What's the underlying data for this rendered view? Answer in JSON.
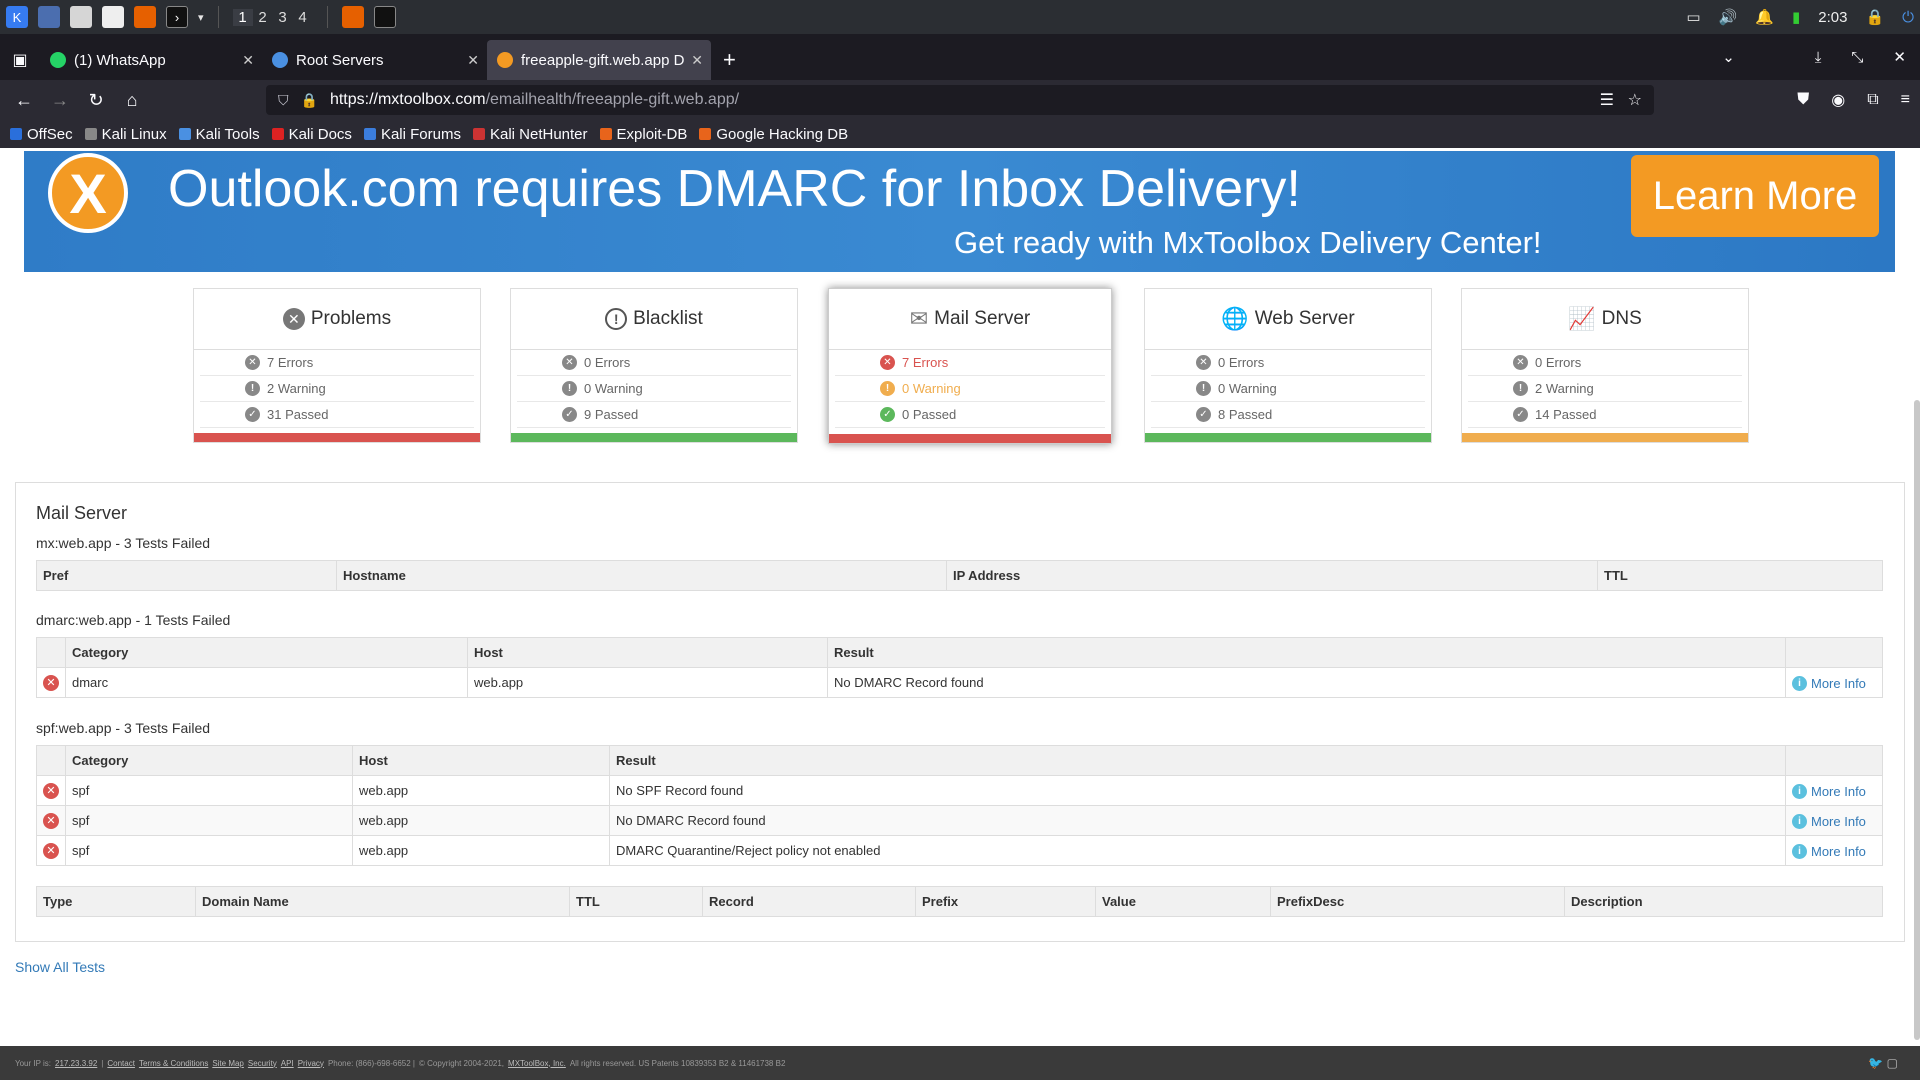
{
  "taskbar": {
    "workspaces": [
      "1",
      "2",
      "3",
      "4"
    ],
    "clock": "2:03"
  },
  "tabs": [
    {
      "label": "(1) WhatsApp"
    },
    {
      "label": "Root Servers"
    },
    {
      "label": "freeapple-gift.web.app D"
    }
  ],
  "url": {
    "host": "https://mxtoolbox.com",
    "path": "/emailhealth/freeapple-gift.web.app/"
  },
  "bookmarks": [
    "OffSec",
    "Kali Linux",
    "Kali Tools",
    "Kali Docs",
    "Kali Forums",
    "Kali NetHunter",
    "Exploit-DB",
    "Google Hacking DB"
  ],
  "banner": {
    "title": "Outlook.com requires DMARC for Inbox Delivery!",
    "subtitle": "Get ready with MxToolbox Delivery Center!",
    "button": "Learn More"
  },
  "cards": [
    {
      "title": "Problems",
      "errors": "7 Errors",
      "warning": "2 Warning",
      "passed": "31 Passed",
      "bar_color": "#d9534f"
    },
    {
      "title": "Blacklist",
      "errors": "0 Errors",
      "warning": "0 Warning",
      "passed": "9 Passed",
      "bar_color": "#5cb85c"
    },
    {
      "title": "Mail Server",
      "errors": "7 Errors",
      "warning": "0 Warning",
      "passed": "0 Passed",
      "bar_color": "#d9534f"
    },
    {
      "title": "Web Server",
      "errors": "0 Errors",
      "warning": "0 Warning",
      "passed": "8 Passed",
      "bar_color": "#5cb85c"
    },
    {
      "title": "DNS",
      "errors": "0 Errors",
      "warning": "2 Warning",
      "passed": "14 Passed",
      "bar_color": "#f0ad4e"
    }
  ],
  "panel": {
    "title": "Mail Server",
    "mx": {
      "heading": "mx:web.app - 3 Tests Failed",
      "cols": [
        "Pref",
        "Hostname",
        "IP Address",
        "TTL"
      ]
    },
    "dmarc": {
      "heading": "dmarc:web.app - 1 Tests Failed",
      "cols": [
        "Category",
        "Host",
        "Result"
      ],
      "rows": [
        {
          "category": "dmarc",
          "host": "web.app",
          "result": "No DMARC Record found",
          "info": "More Info"
        }
      ]
    },
    "spf": {
      "heading": "spf:web.app - 3 Tests Failed",
      "cols": [
        "Category",
        "Host",
        "Result"
      ],
      "rows": [
        {
          "category": "spf",
          "host": "web.app",
          "result": "No SPF Record found",
          "info": "More Info"
        },
        {
          "category": "spf",
          "host": "web.app",
          "result": "No DMARC Record found",
          "info": "More Info"
        },
        {
          "category": "spf",
          "host": "web.app",
          "result": "DMARC Quarantine/Reject policy not enabled",
          "info": "More Info"
        }
      ]
    },
    "records": {
      "cols": [
        "Type",
        "Domain Name",
        "TTL",
        "Record",
        "Prefix",
        "Value",
        "PrefixDesc",
        "Description"
      ]
    }
  },
  "show_all": "Show All Tests",
  "footer": {
    "ip_label": "Your IP is:",
    "ip": "217.23.3.92",
    "links": [
      "Contact",
      "Terms & Conditions",
      "Site Map",
      "Security",
      "API",
      "Privacy"
    ],
    "phone": "Phone: (866)-698-6652 |",
    "copyright": "© Copyright 2004-2021,",
    "company": "MXToolBox, Inc.",
    "rights": "All rights reserved. US Patents 10839353 B2 & 11461738 B2"
  }
}
